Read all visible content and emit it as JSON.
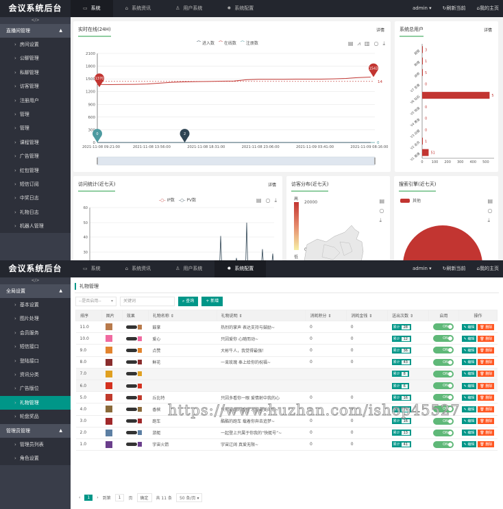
{
  "app_title": "会议系统后台",
  "dashboard": {
    "nav_tabs": [
      {
        "label": "系统",
        "icon": "monitor-icon",
        "active": true
      },
      {
        "label": "系统资讯",
        "icon": "lock-icon",
        "active": false
      },
      {
        "label": "用户系统",
        "icon": "user-icon",
        "active": false
      },
      {
        "label": "系统配置",
        "icon": "gear-icon",
        "active": false
      }
    ],
    "user": "admin ▾",
    "refresh": "刷新当前",
    "home": "我的主页",
    "sidebar_toggle": "</>",
    "sidebar_group": {
      "label": "直播间管理",
      "caret": "▲"
    },
    "sidebar_items": [
      "房间设置",
      "公聊管理",
      "私聊管理",
      "访客管理",
      "注册用户",
      "管理",
      "管理",
      "课程管理",
      "广告管理",
      "红包管理",
      "短信订阅",
      "中奖日志",
      "礼物日志",
      "机器人管理"
    ],
    "cards": {
      "online": {
        "title": "实时在线(24H)",
        "more": "详情"
      },
      "users": {
        "title": "系统总用户",
        "more": "详情"
      },
      "visits": {
        "title": "访问统计(近七天)",
        "more": "详情"
      },
      "geo": {
        "title": "访客分布(近七天)"
      },
      "search": {
        "title": "搜索引擎(近七天)"
      }
    }
  },
  "chart_data": [
    {
      "type": "line",
      "title": "实时在线(24H)",
      "legend": [
        "进入数",
        "在线数",
        "注册数"
      ],
      "x_ticks": [
        "2021-11-08 09:21:00",
        "2021-11-08 13:56:00",
        "2021-11-08 18:31:00",
        "2021-11-08 23:06:00",
        "2021-11-09 03:41:00",
        "2021-11-09 08:16:00"
      ],
      "y_ticks": [
        0,
        300,
        600,
        900,
        1200,
        1500,
        1800,
        2100
      ],
      "ylim": [
        0,
        2100
      ],
      "series": [
        {
          "name": "在线数",
          "color": "#c23531",
          "values": [
            1370,
            1365,
            1370,
            1372,
            1380,
            1400,
            1420,
            1430,
            1435,
            1440,
            1445,
            1450,
            1480,
            1490,
            1490,
            1490,
            1495,
            1495,
            1495,
            1500,
            1510,
            1530,
            1543
          ]
        },
        {
          "name": "注册数",
          "color": "#4c9aa0",
          "values": [
            0,
            0,
            0,
            0,
            0,
            0,
            0,
            0,
            0,
            0,
            0,
            0,
            0,
            0,
            0,
            0,
            0,
            0,
            0,
            0,
            0,
            0,
            0
          ]
        },
        {
          "name": "进入数",
          "color": "#2f4554",
          "values": [
            0,
            0,
            0,
            0,
            2,
            0,
            0,
            0,
            0,
            0,
            0,
            0,
            0,
            0,
            0,
            0,
            0,
            0,
            0,
            0,
            0,
            0,
            0
          ]
        }
      ],
      "markers": [
        {
          "label": "1370",
          "series": "在线数",
          "kind": "min"
        },
        {
          "label": "1543",
          "series": "在线数",
          "kind": "max"
        },
        {
          "label": "0",
          "series": "注册数",
          "kind": "min"
        },
        {
          "label": "2",
          "series": "进入数",
          "kind": "max"
        }
      ],
      "avg_line_label": "14",
      "end_label": "0"
    },
    {
      "type": "bar",
      "orientation": "horizontal",
      "title": "系统总用户",
      "categories": [
        "V1 普通",
        "V2 会员",
        "V3 白银",
        "V4 黄金",
        "V5 铂金",
        "V6 钻石",
        "V7 至尊",
        "讲师",
        "助理",
        "超管"
      ],
      "values": [
        51,
        1,
        0,
        0,
        0,
        530,
        0,
        5,
        1,
        3
      ],
      "value_labels": [
        "51",
        "1",
        "0",
        "0",
        "0",
        "5",
        "0",
        "5",
        "1",
        "3"
      ],
      "x_ticks": [
        0,
        100,
        200,
        300,
        400,
        500
      ],
      "xlim": [
        0,
        560
      ]
    },
    {
      "type": "line",
      "title": "访问统计(近七天)",
      "legend": [
        "IP数",
        "PV数"
      ],
      "y_ticks": [
        30,
        40,
        50,
        60
      ],
      "ylim": [
        25,
        60
      ],
      "spikes": [
        41,
        26,
        50,
        32,
        29
      ]
    },
    {
      "type": "heatmap",
      "title": "访客分布(近七天)",
      "visual_map": {
        "high_label": "高",
        "low_label": "低",
        "max": "20000",
        "min": "0"
      }
    },
    {
      "type": "pie",
      "title": "搜索引擎(近七天)",
      "legend": [
        "其他"
      ],
      "values": [
        100
      ]
    }
  ],
  "gifts_page": {
    "nav_tabs": [
      {
        "label": "系统",
        "icon": "monitor-icon",
        "active": false
      },
      {
        "label": "系统资讯",
        "icon": "lock-icon",
        "active": false
      },
      {
        "label": "用户系统",
        "icon": "user-icon",
        "active": false
      },
      {
        "label": "系统配置",
        "icon": "gear-icon",
        "active": true
      }
    ],
    "user": "admin ▾",
    "refresh": "刷新当前",
    "home": "我的主页",
    "sidebar_toggle": "</>",
    "groups": [
      {
        "label": "全局设置",
        "items": [
          "基本设置",
          "图片处理",
          "会员服务",
          "短信接口",
          "登陆接口",
          "资讯分类",
          "广告版位",
          "礼物管理",
          "轮盘奖品"
        ],
        "active": "礼物管理"
      },
      {
        "label": "管理员管理",
        "items": [
          "管理员列表",
          "角色设置"
        ]
      }
    ],
    "breadcrumb": "礼物管理",
    "filter": {
      "select_placeholder": "--是否启用--",
      "keyword_placeholder": "关键词",
      "search_btn": "查询",
      "add_btn": "+ 新增"
    },
    "columns": [
      "排序",
      "图片",
      "效果",
      "礼物名称 ⇕",
      "礼物说明 ⇕",
      "消耗积分 ⇕",
      "消耗金钱 ⇕",
      "送出次数 ⇕",
      "启用",
      "操作"
    ],
    "rows": [
      {
        "order": "11.0",
        "name": "鼓掌",
        "desc": "热烈的掌声 表达支持与鼓励~",
        "points": "0",
        "money": "0",
        "sent": "28",
        "color": "#b87a4b"
      },
      {
        "order": "10.0",
        "name": "爱心",
        "desc": "只因爱你 心随而动~",
        "points": "0",
        "money": "0",
        "sent": "12",
        "color": "#f06aa0"
      },
      {
        "order": "9.0",
        "name": "点赞",
        "desc": "大彬牛人，我觉得最强！",
        "points": "0",
        "money": "0",
        "sent": "36",
        "color": "#e2842e"
      },
      {
        "order": "8.0",
        "name": "鲜花",
        "desc": "一束玫瑰 奉上给你的祝福~",
        "points": "0",
        "money": "0",
        "sent": "43",
        "color": "#8a2d2d"
      },
      {
        "order": "7.0",
        "name": "",
        "desc": "",
        "points": "",
        "money": "",
        "sent": "8",
        "color": "#e0a020"
      },
      {
        "order": "6.0",
        "name": "",
        "desc": "",
        "points": "",
        "money": "",
        "sent": "6",
        "color": "#d4311f"
      },
      {
        "order": "5.0",
        "name": "丘比特",
        "desc": "只因多看你一眼 爱情射中我的心",
        "points": "0",
        "money": "0",
        "sent": "16",
        "color": "#c0392b"
      },
      {
        "order": "4.0",
        "name": "香槟",
        "desc": "只有最纯的香槟 才配最美的你~",
        "points": "0",
        "money": "0",
        "sent": "21",
        "color": "#8a6a3a"
      },
      {
        "order": "3.0",
        "name": "跑车",
        "desc": "酷酷的跑车 载着你奔去追梦~",
        "points": "0",
        "money": "0",
        "sent": "16",
        "color": "#a0282a"
      },
      {
        "order": "2.0",
        "name": "游艇",
        "desc": "一起登上只属于你我的“快艇号”~",
        "points": "0",
        "money": "0",
        "sent": "13",
        "color": "#5c7fa3"
      },
      {
        "order": "1.0",
        "name": "宇宙火箭",
        "desc": "宇宙辽阔 真爱无限~",
        "points": "0",
        "money": "0",
        "sent": "41",
        "color": "#6a3e8c"
      }
    ],
    "row_labels": {
      "count_prefix": "累计",
      "switch": "ON",
      "edit": "✎ 编辑",
      "delete": "🗑 删除"
    },
    "pager": {
      "prev": "‹",
      "current": "1",
      "next": "›",
      "goto": "到第",
      "page_input": "1",
      "page_unit": "页",
      "confirm": "确定",
      "total": "共 11 条",
      "per_page": "50 条/页 ▾"
    }
  },
  "watermark": "https://www.huzhan.com/ishop45527"
}
